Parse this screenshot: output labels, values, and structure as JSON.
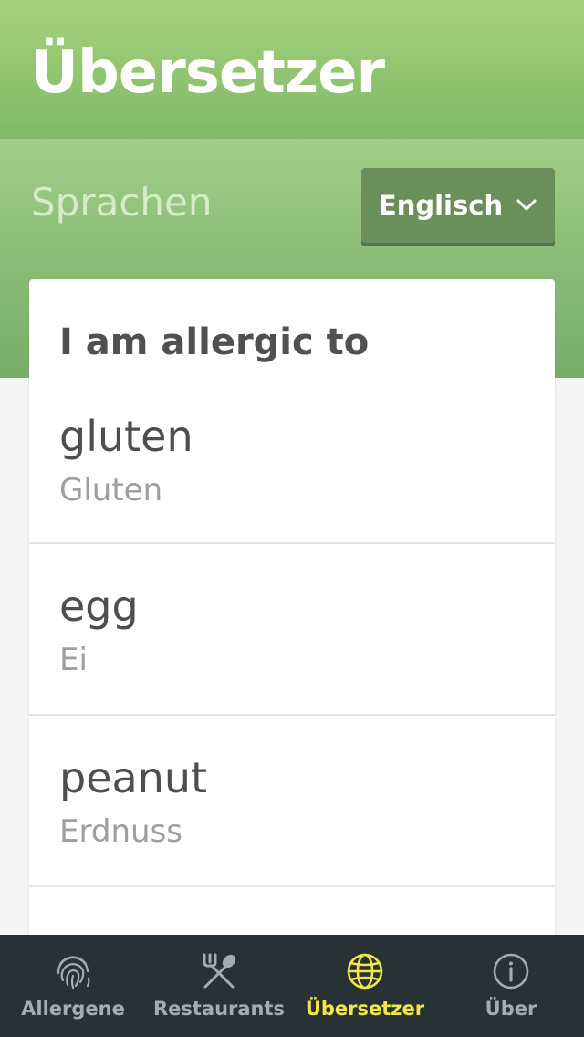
{
  "header": {
    "title": "Übersetzer"
  },
  "language": {
    "label": "Sprachen",
    "selected": "Englisch",
    "icon": "chevron-down-icon"
  },
  "card": {
    "title": "I am allergic to",
    "items": [
      {
        "translation": "gluten",
        "original": "Gluten"
      },
      {
        "translation": "egg",
        "original": "Ei"
      },
      {
        "translation": "peanut",
        "original": "Erdnuss"
      }
    ]
  },
  "tabs": [
    {
      "label": "Allergene",
      "icon": "fingerprint-icon",
      "active": false
    },
    {
      "label": "Restaurants",
      "icon": "fork-spoon-icon",
      "active": false
    },
    {
      "label": "Übersetzer",
      "icon": "globe-icon",
      "active": true
    },
    {
      "label": "Über",
      "icon": "info-icon",
      "active": false
    }
  ],
  "colors": {
    "header_green": "#8fc56f",
    "tab_bar": "#283134",
    "tab_inactive": "#a5acaf",
    "tab_active": "#f3e54a",
    "dropdown": "#6b8f5a"
  }
}
